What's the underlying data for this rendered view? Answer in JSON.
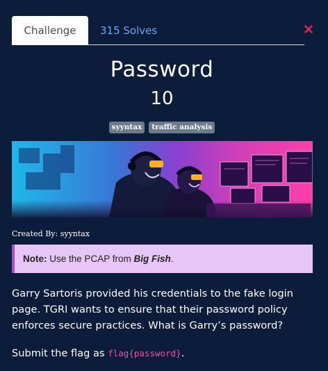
{
  "tabs": {
    "challenge_label": "Challenge",
    "solves_label": "315 Solves"
  },
  "challenge": {
    "title": "Password",
    "points": "10",
    "tags": [
      "syyntax",
      "traffic analysis"
    ],
    "banner_icon": "cyberpunk-hackers-image",
    "created_by": "Created By: syyntax",
    "note": {
      "label": "Note:",
      "text_before": " Use the PCAP from ",
      "emphasis": "Big Fish",
      "text_after": "."
    },
    "description": "Garry Sartoris provided his credentials to the fake login page. TGRI wants to ensure that their password policy enforces secure practices. What is Garry’s password?",
    "submit_prefix": "Submit the flag as ",
    "flag_format": "flag{password}",
    "submit_suffix": "."
  },
  "colors": {
    "background": "#0b1d3a",
    "tab_link": "#6ea8e6",
    "close": "#e0245e",
    "tag_bg": "#6c7a8c",
    "note_bg": "#e7c6f7",
    "note_border": "#a24fd3",
    "flag_code": "#e05aa4"
  }
}
